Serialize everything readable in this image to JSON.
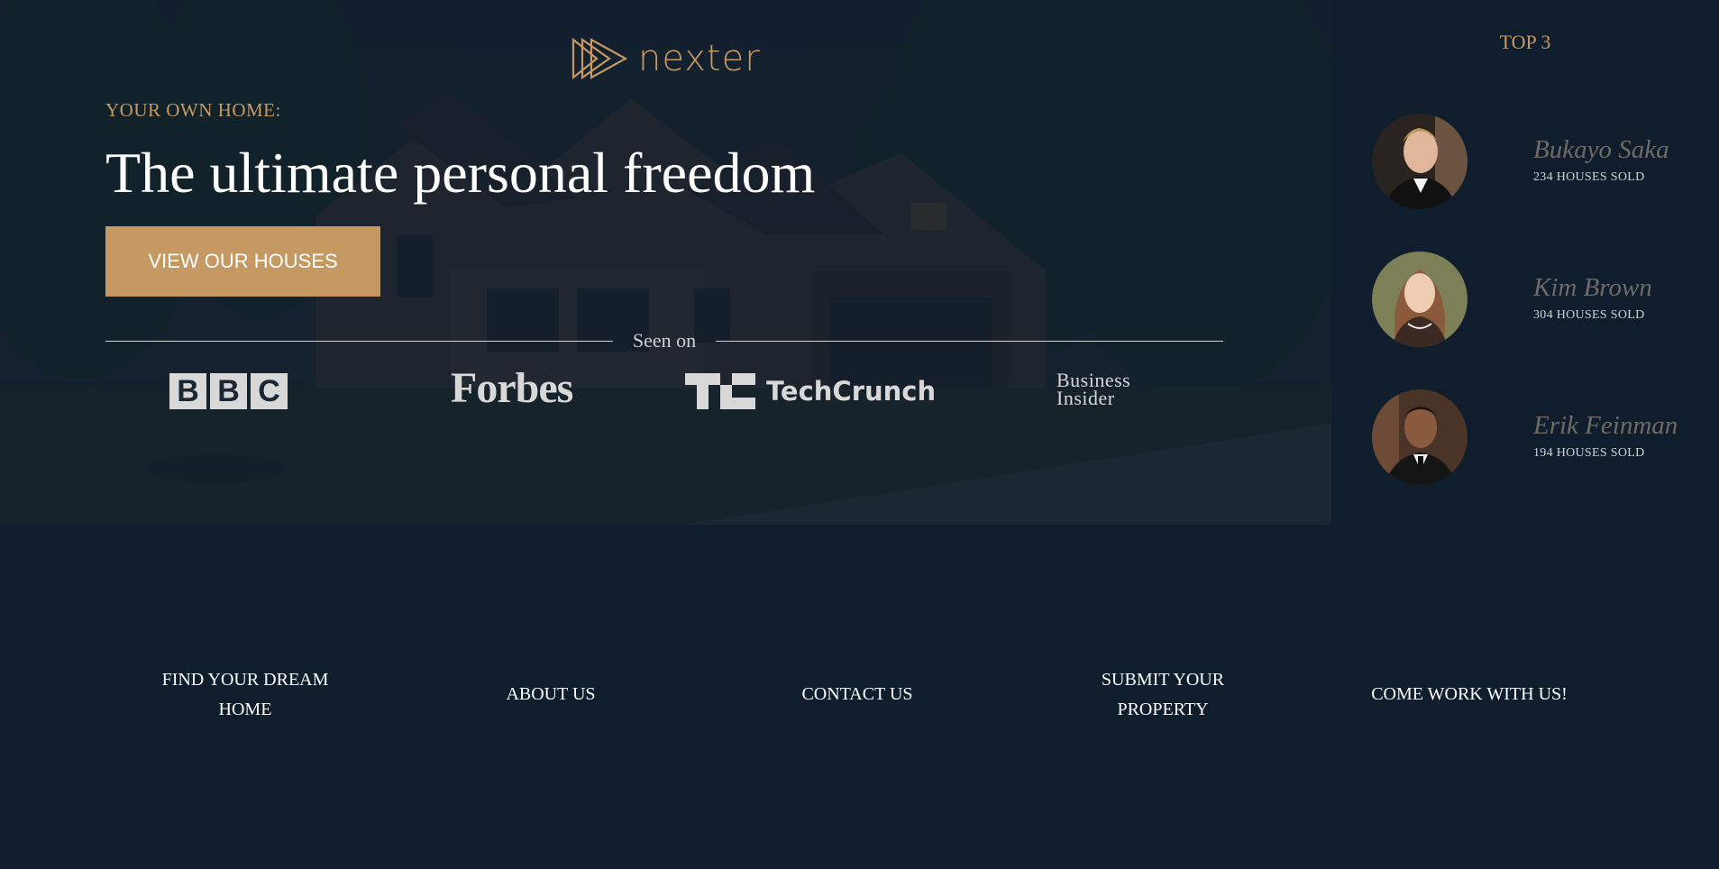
{
  "brand": {
    "name": "nexter",
    "accent_color": "#c69963",
    "dark_color": "#101d2c"
  },
  "hero": {
    "subtitle": "YOUR OWN HOME:",
    "title": "The ultimate personal freedom",
    "cta_label": "VIEW OUR HOUSES",
    "seen_on_label": "Seen on",
    "press_logos": {
      "bbc": [
        "B",
        "B",
        "C"
      ],
      "forbes": "Forbes",
      "techcrunch": "TechCrunch",
      "business_insider": [
        "Business",
        "Insider"
      ]
    }
  },
  "realtors": {
    "title": "TOP 3",
    "items": [
      {
        "name": "Bukayo Saka",
        "sold": "234 HOUSES SOLD"
      },
      {
        "name": "Kim Brown",
        "sold": "304 HOUSES SOLD"
      },
      {
        "name": "Erik Feinman",
        "sold": "194 HOUSES SOLD"
      }
    ]
  },
  "nav": {
    "items": [
      {
        "label": "FIND YOUR DREAM HOME"
      },
      {
        "label": "ABOUT US"
      },
      {
        "label": "CONTACT US"
      },
      {
        "label": "SUBMIT YOUR PROPERTY"
      },
      {
        "label": "COME WORK WITH US!"
      }
    ]
  }
}
